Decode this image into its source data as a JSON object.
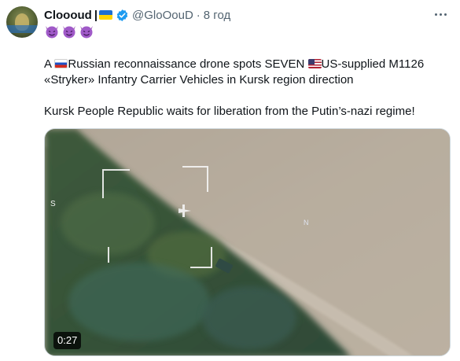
{
  "tweet": {
    "author": {
      "display_name": "Clooоud",
      "name_separator": "|",
      "handle": "@GloOouD",
      "time": "8 год"
    },
    "emoji_line_icons": [
      "smiling-devil-emoji",
      "smiling-devil-emoji",
      "smiling-devil-emoji"
    ],
    "text": {
      "p1_start": "A ",
      "p1_after_ru_flag": "Russian reconnaissance drone spots SEVEN ",
      "p1_after_us_flag": "US-supplied M1126",
      "p1_line2": "«Stryker» Infantry Carrier Vehicles in Kursk region direction",
      "p2": "Kursk People Republic waits for liberation from the Putin’s-nazi regime!"
    },
    "media": {
      "duration": "0:27",
      "hud_markers": {
        "left": "S",
        "right": "N"
      }
    }
  },
  "colors": {
    "text_primary": "#0f1419",
    "text_secondary": "#536471",
    "verified_blue": "#1d9bf0"
  }
}
